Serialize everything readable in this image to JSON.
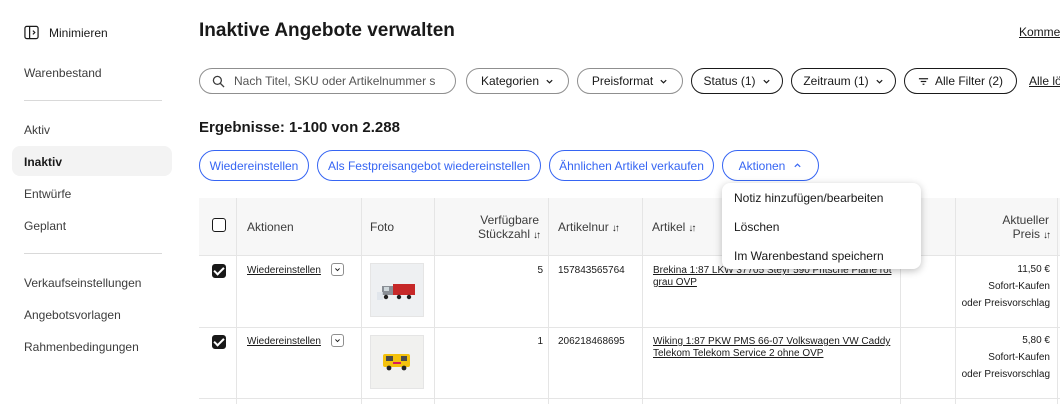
{
  "sidebar": {
    "minimize_label": "Minimieren",
    "inventory_label": "Warenbestand",
    "items": [
      {
        "label": "Aktiv"
      },
      {
        "label": "Inaktiv"
      },
      {
        "label": "Entwürfe"
      },
      {
        "label": "Geplant"
      }
    ],
    "bottom_items": [
      {
        "label": "Verkaufseinstellungen"
      },
      {
        "label": "Angebotsvorlagen"
      },
      {
        "label": "Rahmenbedingungen"
      }
    ]
  },
  "page": {
    "title": "Inaktive Angebote verwalten",
    "top_right_link": "Komme"
  },
  "filters": {
    "search_placeholder": "Nach Titel, SKU oder Artikelnummer s",
    "categories": "Kategorien",
    "price_format": "Preisformat",
    "status": "Status (1)",
    "period": "Zeitraum (1)",
    "all_filters": "Alle Filter (2)",
    "all_link": "Alle lö"
  },
  "results": "Ergebnisse: 1-100 von 2.288",
  "actions": {
    "relist": "Wiedereinstellen",
    "relist_fixed": "Als Festpreisangebot wiedereinstellen",
    "sell_similar": "Ähnlichen Artikel verkaufen",
    "actions": "Aktionen"
  },
  "dropdown": {
    "items": [
      {
        "label": "Notiz hinzufügen/bearbeiten"
      },
      {
        "label": "Löschen"
      },
      {
        "label": "Im Warenbestand speichern"
      }
    ]
  },
  "table": {
    "headers": {
      "actions": "Aktionen",
      "photo": "Foto",
      "qty_line1": "Verfügbare",
      "qty_line2": "Stückzahl",
      "item_number": "Artikelnur",
      "article": "Artikel",
      "price_line1": "Aktueller",
      "price_line2": "Preis"
    },
    "rows": [
      {
        "checked": true,
        "action": "Wiedereinstellen",
        "qty": "5",
        "item_number": "157843565764",
        "title_line1": "Brekina 1:87 LKW 37705 Steyr 590 Pritsche Plane rot",
        "title_line2": "grau OVP",
        "price": "11,50 €",
        "format_line1": "Sofort-Kaufen",
        "format_line2": "oder Preisvorschlag"
      },
      {
        "checked": true,
        "action": "Wiedereinstellen",
        "qty": "1",
        "item_number": "206218468695",
        "title_line1": "Wiking 1:87 PKW PMS 66-07 Volkswagen VW Caddy",
        "title_line2": "Telekom Telekom Service 2 ohne OVP",
        "price": "5,80 €",
        "format_line1": "Sofort-Kaufen",
        "format_line2": "oder Preisvorschlag"
      }
    ]
  },
  "colors": {
    "accent": "#3665f3",
    "text": "#191919"
  }
}
